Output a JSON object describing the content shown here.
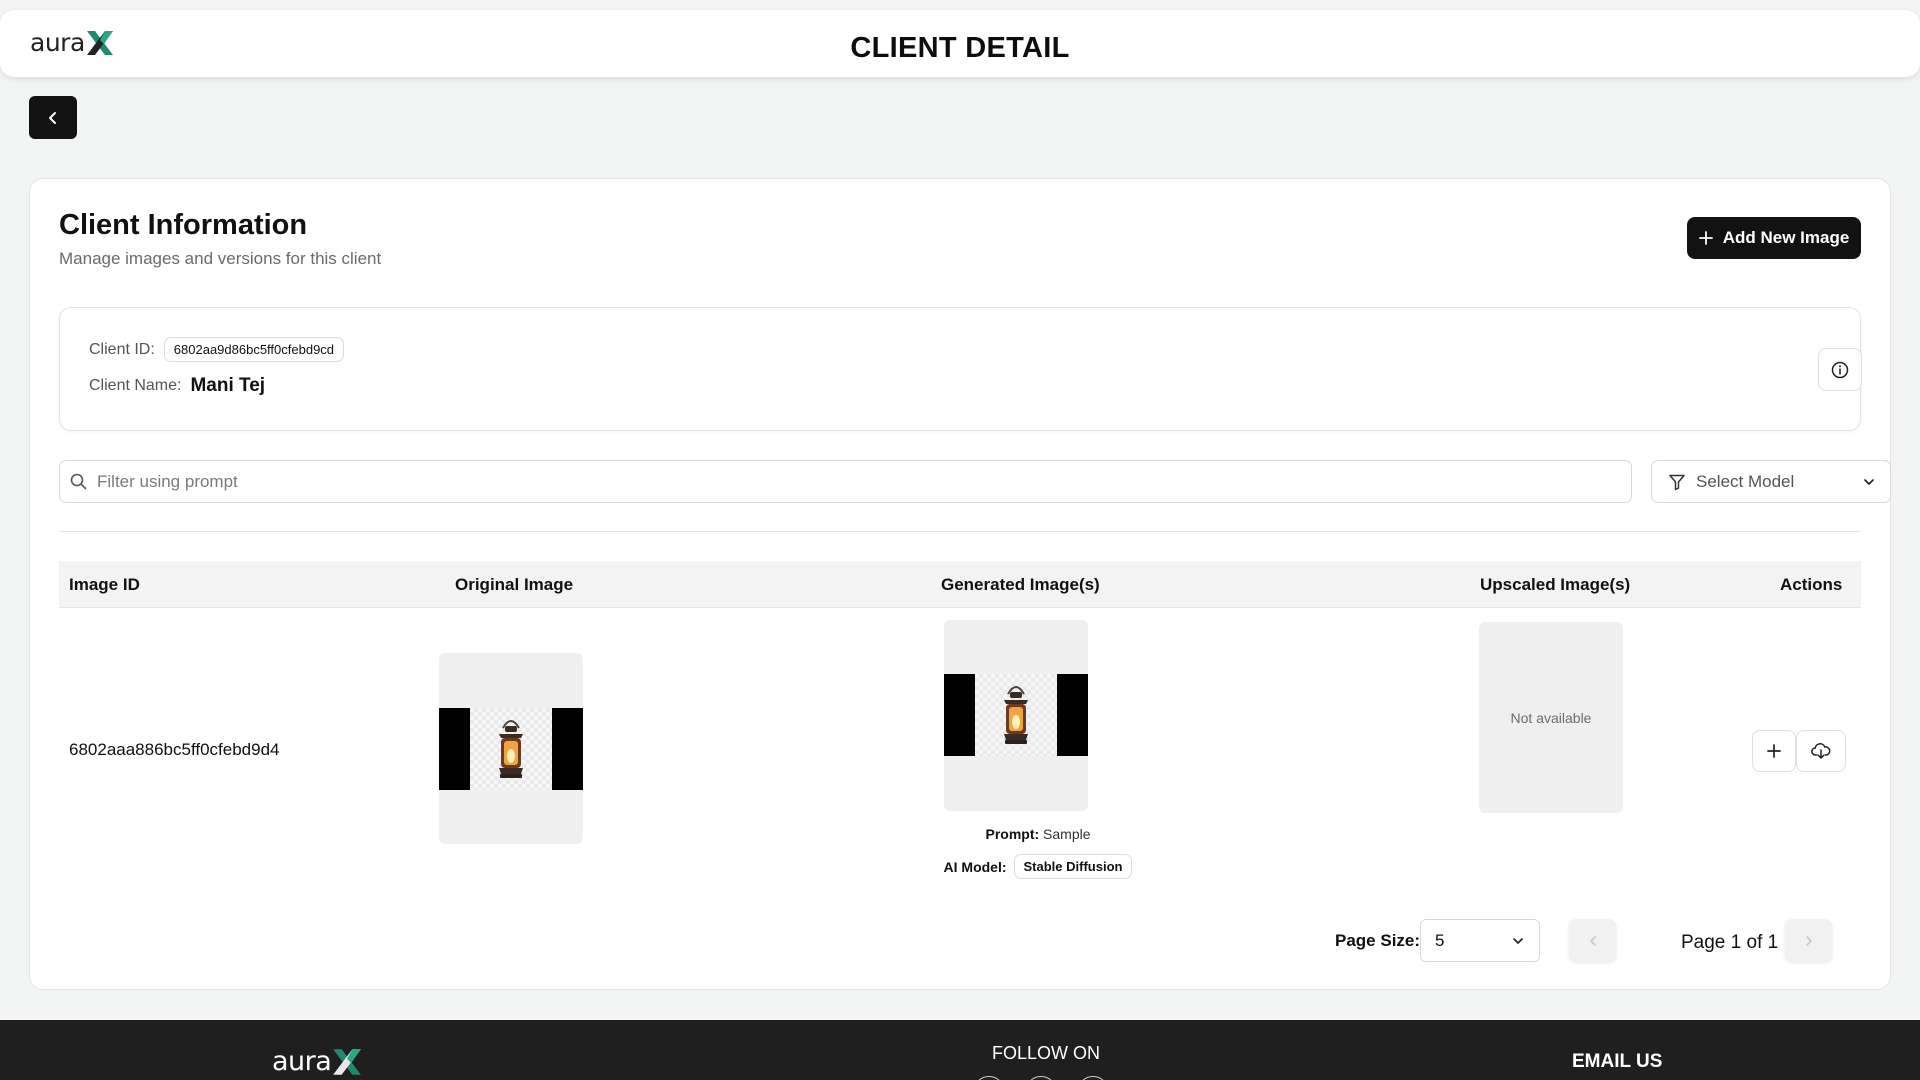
{
  "header": {
    "logo_text": "aura",
    "logo_mark": "X",
    "title": "CLIENT DETAIL",
    "back_icon": "chevron-left-icon"
  },
  "client_section": {
    "title": "Client Information",
    "subtitle": "Manage images and versions for this client",
    "add_button_label": "Add New Image",
    "add_button_icon": "plus-icon",
    "client_id_label": "Client ID:",
    "client_id_value": "6802aa9d86bc5ff0cfebd9cd",
    "client_name_label": "Client Name:",
    "client_name_value": "Mani Tej",
    "info_icon": "info-icon"
  },
  "filters": {
    "search_placeholder": "Filter using prompt",
    "search_value": "",
    "search_icon": "search-icon",
    "model_select_label": "Select Model",
    "model_select_icon": "filter-icon"
  },
  "table": {
    "columns": [
      "Image ID",
      "Original Image",
      "Generated Image(s)",
      "Upscaled Image(s)",
      "Actions"
    ],
    "rows": [
      {
        "image_id": "6802aaa886bc5ff0cfebd9d4",
        "original_image": "lantern-image",
        "generated_image": "lantern-image",
        "prompt_label": "Prompt:",
        "prompt_value": "Sample",
        "model_label": "AI Model:",
        "model_value": "Stable Diffusion",
        "upscaled_text": "Not available",
        "actions": [
          "plus-icon",
          "cloud-download-icon"
        ]
      }
    ]
  },
  "pagination": {
    "page_size_label": "Page Size:",
    "page_size_value": "5",
    "page_text": "Page 1 of 1",
    "prev_icon": "chevron-left-icon",
    "next_icon": "chevron-right-icon"
  },
  "footer": {
    "logo_text": "aura",
    "logo_mark": "X",
    "follow_label": "FOLLOW ON",
    "email_label": "EMAIL US"
  },
  "colors": {
    "background": "#f2f3f3",
    "primary_dark": "#121212",
    "logo_accent": "#1f8a70",
    "footer_bg": "#1f1f1f"
  }
}
